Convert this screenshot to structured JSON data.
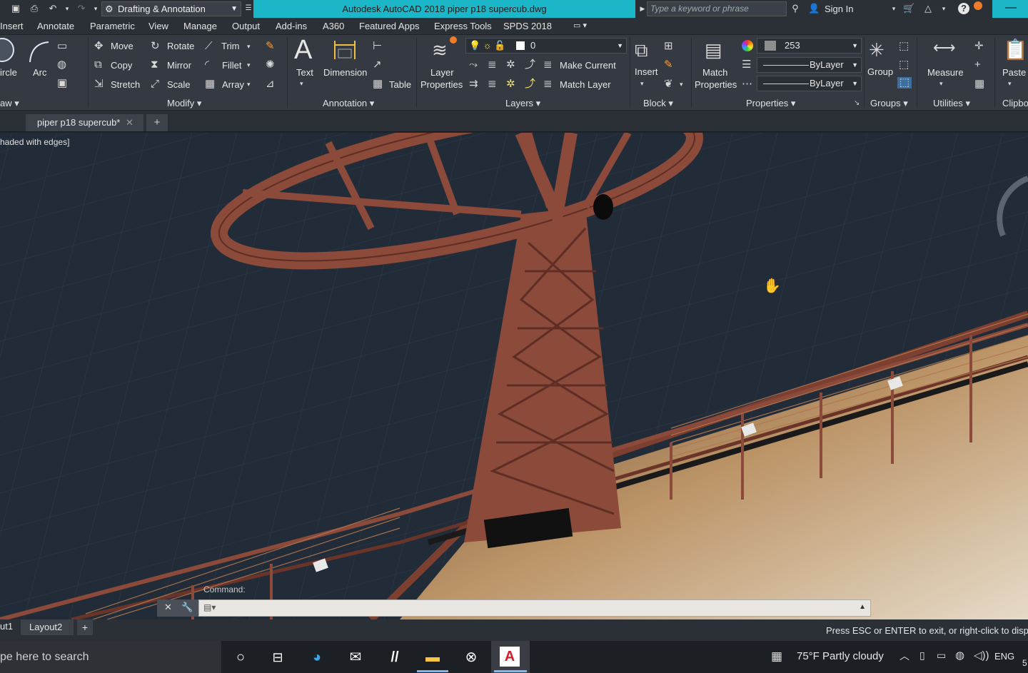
{
  "titlebar": {
    "workspace": "Drafting & Annotation",
    "title": "Autodesk AutoCAD 2018    piper p18 supercub.dwg",
    "search_placeholder": "Type a keyword or phrase",
    "sign_in": "Sign In"
  },
  "menu": [
    "Insert",
    "Annotate",
    "Parametric",
    "View",
    "Manage",
    "Output",
    "Add-ins",
    "A360",
    "Featured Apps",
    "Express Tools",
    "SPDS 2018"
  ],
  "ribbon": {
    "draw": {
      "circle": "ircle",
      "arc": "Arc",
      "panel": "aw"
    },
    "modify": {
      "move": "Move",
      "rotate": "Rotate",
      "trim": "Trim",
      "copy": "Copy",
      "mirror": "Mirror",
      "fillet": "Fillet",
      "stretch": "Stretch",
      "scale": "Scale",
      "array": "Array",
      "panel": "Modify"
    },
    "annotation": {
      "text": "Text",
      "dimension": "Dimension",
      "table": "Table",
      "panel": "Annotation"
    },
    "layers": {
      "layer_properties_1": "Layer",
      "layer_properties_2": "Properties",
      "current_layer": "0",
      "make_current": "Make Current",
      "match_layer": "Match Layer",
      "panel": "Layers"
    },
    "block": {
      "insert": "Insert",
      "panel": "Block"
    },
    "properties": {
      "match_1": "Match",
      "match_2": "Properties",
      "color": "253",
      "linetype": "ByLayer",
      "lineweight": "ByLayer",
      "panel": "Properties"
    },
    "groups": {
      "group": "Group",
      "panel": "Groups"
    },
    "utilities": {
      "measure": "Measure",
      "panel": "Utilities"
    },
    "clipboard": {
      "paste": "Paste",
      "panel": "Clipbo"
    }
  },
  "file_tab": "piper p18 supercub*",
  "viewport": {
    "visual_style": "haded with edges]"
  },
  "command": {
    "hint": "Command:"
  },
  "layout_tabs": [
    "ut1",
    "Layout2"
  ],
  "status_text": "Press ESC or ENTER to exit, or right-click to disp",
  "taskbar": {
    "search": "pe here to search",
    "weather": "75°F  Partly cloudy",
    "language": "ENG",
    "clock_partial": "5"
  },
  "colors": {
    "accent": "#1bb6c7",
    "ribbon_bg": "#343942",
    "viewport_bg": "#222b38",
    "model_color": "#8b4a3a"
  }
}
